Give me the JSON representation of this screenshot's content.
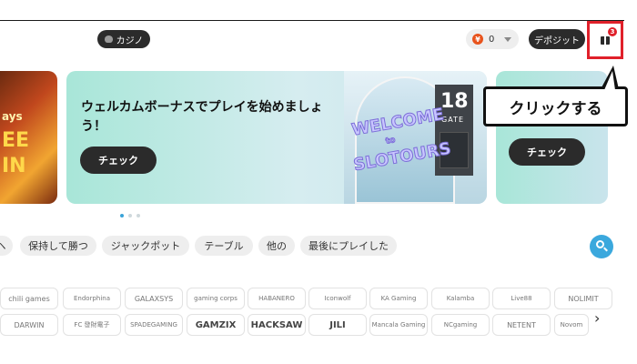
{
  "header": {
    "casino_label": "カジノ",
    "balance": "0",
    "currency_icon": "¥",
    "deposit_label": "デポジット",
    "gift_badge_count": "3",
    "accent_color": "#e0202a"
  },
  "left_banner": {
    "line1": "ays",
    "line2": "EE",
    "line3": "IN"
  },
  "main_banner": {
    "title": "ウェルカムボーナスでプレイを始めましょう！",
    "check_label": "チェック",
    "gate_number": "18",
    "gate_label": "GATE",
    "welcome_line1": "WELCOME",
    "welcome_line2": "to",
    "welcome_line3": "SLOTOURS"
  },
  "right_banner": {
    "check_label": "チェック"
  },
  "callout": {
    "text": "クリックする"
  },
  "carousel": {
    "page_count": 3,
    "active_index": 0
  },
  "categories": [
    "ヘ",
    "保持して勝つ",
    "ジャックポット",
    "テーブル",
    "他の",
    "最後にプレイした"
  ],
  "providers": {
    "row1": [
      "chili games",
      "Endorphina",
      "GALAXSYS",
      "gaming corps",
      "HABANERO",
      "Iconwolf",
      "KA Gaming",
      "Kalamba",
      "Live88",
      "NOLIMIT"
    ],
    "row2": [
      "DARWIN",
      "FC 發財電子",
      "SPADEGAMING",
      "GAMZIX",
      "HACKSAW",
      "JILI",
      "Mancala Gaming",
      "NCgaming",
      "NETENT",
      "Novom"
    ]
  }
}
